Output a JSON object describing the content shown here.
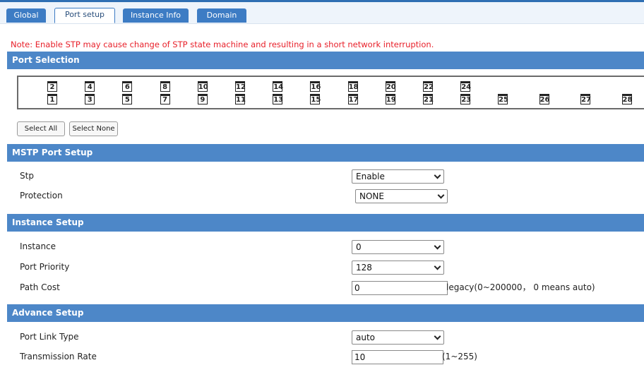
{
  "tabs": [
    {
      "label": "Global",
      "active": false
    },
    {
      "label": "Port setup",
      "active": true
    },
    {
      "label": "Instance Info",
      "active": false
    },
    {
      "label": "Domain",
      "active": false
    }
  ],
  "note": "Note:  Enable STP may cause change of STP state machine and resulting in a short network interruption.",
  "port_selection": {
    "title": "Port Selection",
    "top_ports": [
      "2",
      "4",
      "6",
      "8",
      "10",
      "12",
      "14",
      "16",
      "18",
      "20",
      "22",
      "24"
    ],
    "bottom_ports": [
      "1",
      "3",
      "5",
      "7",
      "9",
      "11",
      "13",
      "15",
      "17",
      "19",
      "21",
      "23"
    ],
    "sfp_ports": [
      "25",
      "26",
      "27",
      "28"
    ],
    "select_all": "Select All",
    "select_none": "Select None"
  },
  "mstp": {
    "title": "MSTP Port Setup",
    "stp_label": "Stp",
    "stp_value": "Enable",
    "protection_label": "Protection",
    "protection_value": "NONE"
  },
  "instance": {
    "title": "Instance Setup",
    "instance_label": "Instance",
    "instance_value": "0",
    "priority_label": "Port Priority",
    "priority_value": "128",
    "pathcost_label": "Path Cost",
    "pathcost_value": "0",
    "pathcost_hint": "legacy(0~200000，  0 means auto)"
  },
  "advance": {
    "title": "Advance Setup",
    "linktype_label": "Port Link Type",
    "linktype_value": "auto",
    "rate_label": "Transmission Rate",
    "rate_value": "10",
    "rate_hint": "(1~255)"
  }
}
